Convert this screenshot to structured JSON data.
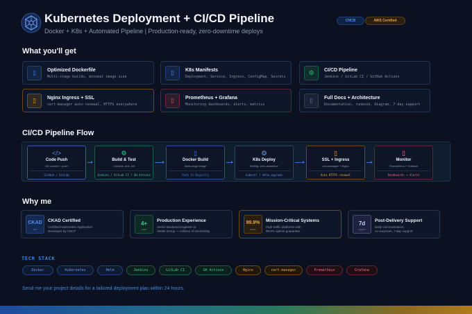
{
  "header": {
    "title": "Kubernetes Deployment + CI/CD Pipeline",
    "subtitle": "Docker + K8s + Automated Pipeline | Production-ready, zero-downtime deploys",
    "badges": [
      "CNCB",
      "AWS Certified"
    ]
  },
  "get_section": {
    "title": "What you'll get",
    "cards": [
      {
        "title": "Optimized Dockerfile",
        "desc": "Multi-stage builds, minimal image size",
        "icon": "docker-icon",
        "color": "#3b82f6"
      },
      {
        "title": "K8s Manifests",
        "desc": "Deployment, Service, Ingress, ConfigMap, Secrets",
        "icon": "file-icon",
        "color": "#3b82f6"
      },
      {
        "title": "CI/CD Pipeline",
        "desc": "Jenkins / GitLab CI / GitHub Actions",
        "icon": "gear-icon",
        "color": "#22c55e"
      },
      {
        "title": "Nginx Ingress + SSL",
        "desc": "cert-manager auto-renewal, HTTPS everywhere",
        "icon": "lock-icon",
        "color": "#f59e0b"
      },
      {
        "title": "Prometheus + Grafana",
        "desc": "Monitoring dashboards, alerts, metrics",
        "icon": "chart-icon",
        "color": "#ef4444"
      },
      {
        "title": "Full Docs + Architecture",
        "desc": "Documentation, runbook, diagram, 7-day support",
        "icon": "doc-icon",
        "color": "#64748b"
      }
    ]
  },
  "flow_section": {
    "title": "CI/CD Pipeline Flow",
    "steps": [
      {
        "title": "Code Push",
        "desc": "Git commit + push",
        "foot": "GitHub / GitLab",
        "icon": "code-icon",
        "glyph": "</>",
        "color": "#5b8ef0"
      },
      {
        "title": "Build & Test",
        "desc": "Compile, test, lint",
        "foot": "Jenkins / GitLab CI / GH Actions",
        "icon": "gear-icon",
        "glyph": "⚙",
        "color": "#3fcf95"
      },
      {
        "title": "Docker Build",
        "desc": "Multi-stage image",
        "foot": "Push to Registry",
        "icon": "docker-icon",
        "glyph": "▯",
        "color": "#3b82f6"
      },
      {
        "title": "K8s Deploy",
        "desc": "Rolling, zero-downtime",
        "foot": "kubectl / Helm upgrade",
        "icon": "helm-icon",
        "glyph": "❂",
        "color": "#5b8ef0"
      },
      {
        "title": "SSL + Ingress",
        "desc": "cert-manager + Nginx",
        "foot": "Auto HTTPS renewal",
        "icon": "lock-icon",
        "glyph": "▯",
        "color": "#e9a743"
      },
      {
        "title": "Monitor",
        "desc": "Prometheus + Grafana",
        "foot": "Dashboards + Alerts",
        "icon": "chart-icon",
        "glyph": "▯",
        "color": "#ef6f84"
      }
    ]
  },
  "why_section": {
    "title": "Why me",
    "cards": [
      {
        "badge": "CKAD",
        "badge_sub": "cert",
        "title": "CKAD Certified",
        "desc": [
          "Certified Kubernetes Application",
          "Developer by CNCF"
        ],
        "color": "#5b8ef0"
      },
      {
        "badge": "4+",
        "badge_sub": "years",
        "title": "Production Experience",
        "desc": [
          "Senior Backend Engineer at",
          "Viettel Group — millions of events/day"
        ],
        "color": "#3fcf95"
      },
      {
        "badge": "99.9%",
        "badge_sub": "uptime",
        "title": "Mission-Critical Systems",
        "desc": [
          "High-traffic platforms with",
          "99.9% uptime guarantee"
        ],
        "color": "#e9a743"
      },
      {
        "badge": "7d",
        "badge_sub": "support",
        "title": "Post-Delivery Support",
        "desc": [
          "Daily communication,",
          "no surprises, 7-day support"
        ],
        "color": "#c7d2fe"
      }
    ]
  },
  "tech_stack": {
    "label": "TECH STACK",
    "chips": [
      {
        "label": "Docker",
        "tone": "blue"
      },
      {
        "label": "Kubernetes",
        "tone": "blue"
      },
      {
        "label": "Helm",
        "tone": "blue"
      },
      {
        "label": "Jenkins",
        "tone": "green"
      },
      {
        "label": "GitLab CI",
        "tone": "green"
      },
      {
        "label": "GH Actions",
        "tone": "green"
      },
      {
        "label": "Nginx",
        "tone": "orange"
      },
      {
        "label": "cert-manager",
        "tone": "orange"
      },
      {
        "label": "Prometheus",
        "tone": "red"
      },
      {
        "label": "Grafana",
        "tone": "red"
      }
    ]
  },
  "cta": "Send me your project details for a tailored deployment plan within 24 hours."
}
